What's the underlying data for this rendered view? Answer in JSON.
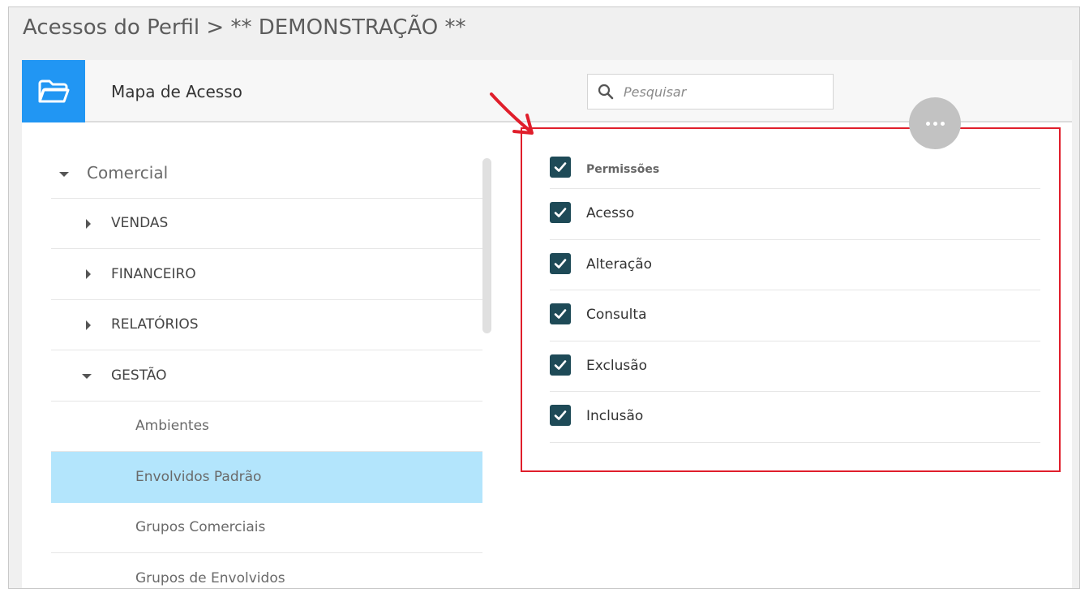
{
  "page": {
    "title": "Acessos do Perfil > ** DEMONSTRAÇÃO **"
  },
  "header": {
    "icon": "folder-open-icon",
    "title": "Mapa de Acesso",
    "search": {
      "placeholder": "Pesquisar",
      "value": "",
      "icon": "search-icon"
    },
    "more_button": {
      "icon": "more-horizontal-icon"
    }
  },
  "tree": {
    "items": [
      {
        "label": "Comercial",
        "level": 0,
        "expanded": true
      },
      {
        "label": "VENDAS",
        "level": 1,
        "expanded": false
      },
      {
        "label": "FINANCEIRO",
        "level": 1,
        "expanded": false
      },
      {
        "label": "RELATÓRIOS",
        "level": 1,
        "expanded": false
      },
      {
        "label": "GESTÃO",
        "level": 1,
        "expanded": true
      },
      {
        "label": "Ambientes",
        "level": 2
      },
      {
        "label": "Envolvidos Padrão",
        "level": 2,
        "selected": true
      },
      {
        "label": "Grupos Comerciais",
        "level": 2
      },
      {
        "label": "Grupos de Envolvidos",
        "level": 2
      }
    ]
  },
  "permissions": {
    "header": {
      "label": "Permissões",
      "checked": true
    },
    "items": [
      {
        "label": "Acesso",
        "checked": true
      },
      {
        "label": "Alteração",
        "checked": true
      },
      {
        "label": "Consulta",
        "checked": true
      },
      {
        "label": "Exclusão",
        "checked": true
      },
      {
        "label": "Inclusão",
        "checked": true
      }
    ]
  },
  "colors": {
    "accent": "#2196f3",
    "selected_row": "#b3e5fc",
    "checkbox": "#1e4a57",
    "highlight_box": "#e01e2b"
  }
}
